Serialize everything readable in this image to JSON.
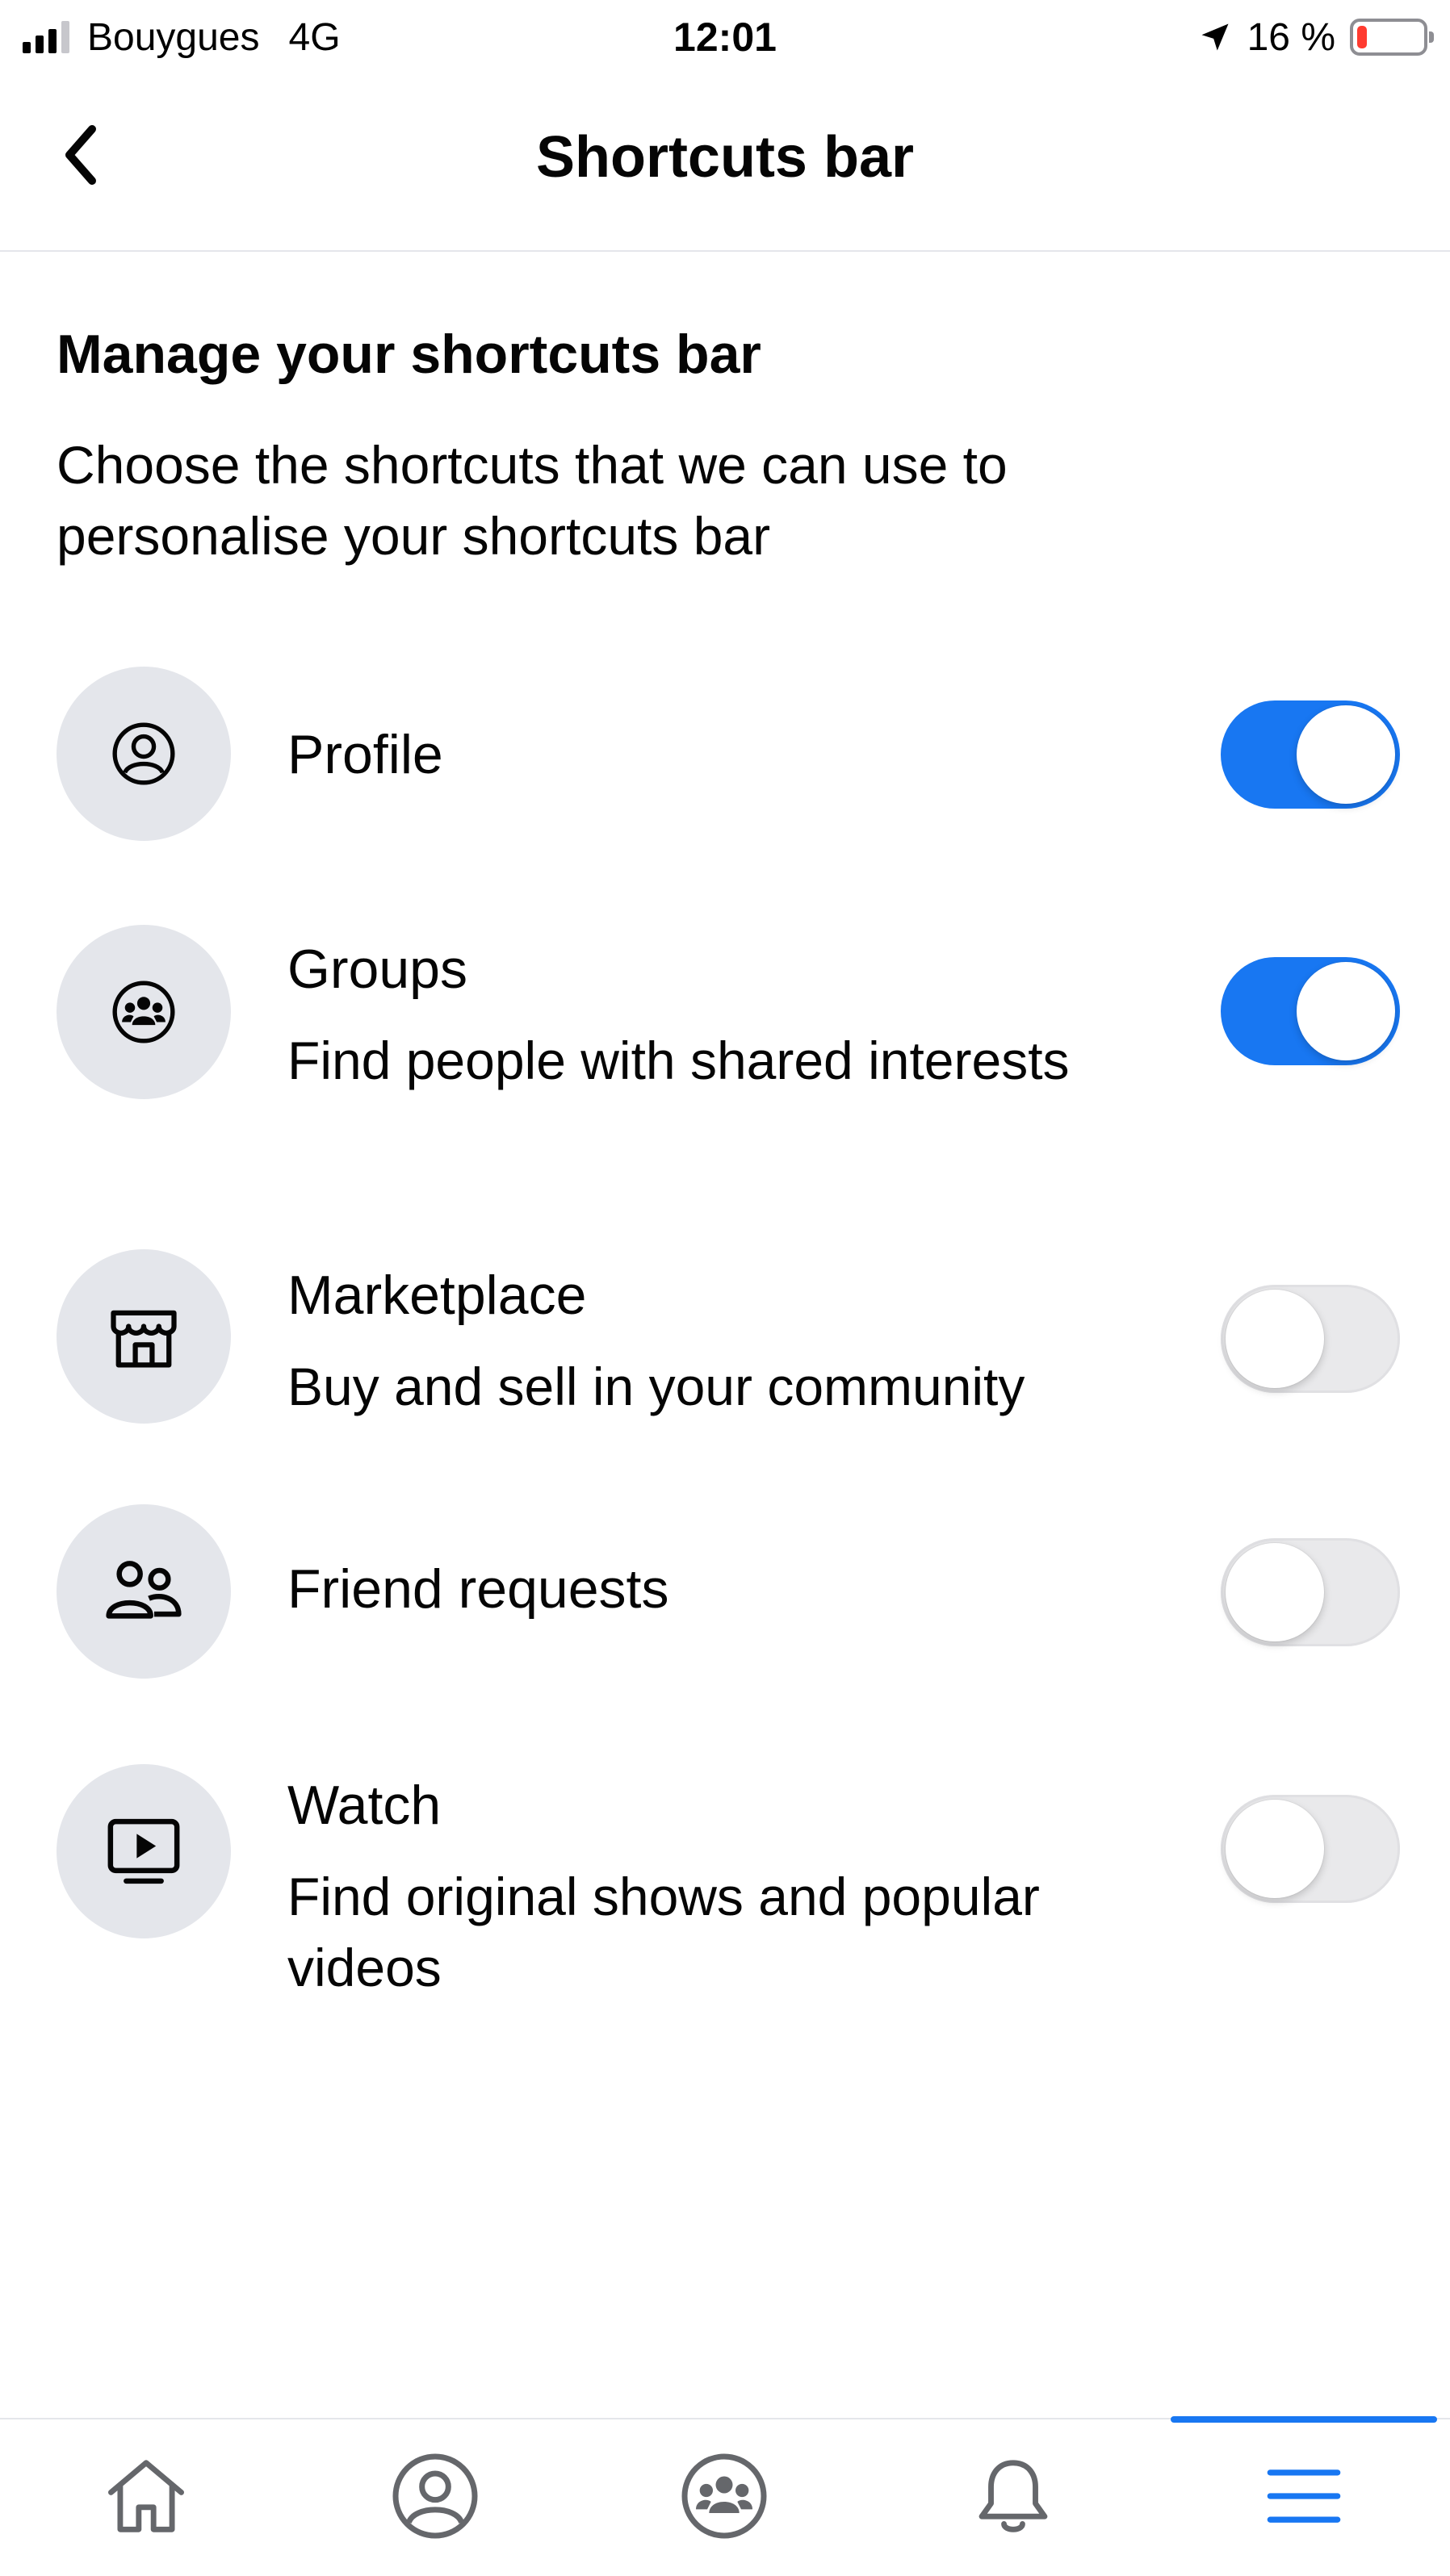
{
  "status_bar": {
    "carrier": "Bouygues",
    "network": "4G",
    "time": "12:01",
    "battery": "16 %",
    "battery_level": 0.16
  },
  "header": {
    "title": "Shortcuts bar",
    "back_icon": "chevron-left-icon"
  },
  "section": {
    "title": "Manage your shortcuts bar",
    "description": "Choose the shortcuts that we can use to personalise your shortcuts bar"
  },
  "shortcuts": [
    {
      "label": "Profile",
      "subtitle": "",
      "icon": "profile-icon",
      "enabled": true
    },
    {
      "label": "Groups",
      "subtitle": "Find people with shared interests",
      "icon": "groups-icon",
      "enabled": true
    },
    {
      "label": "Marketplace",
      "subtitle": "Buy and sell in your community",
      "icon": "marketplace-icon",
      "enabled": false
    },
    {
      "label": "Friend requests",
      "subtitle": "",
      "icon": "friends-icon",
      "enabled": false
    },
    {
      "label": "Watch",
      "subtitle": "Find original shows and popular videos",
      "icon": "watch-icon",
      "enabled": false
    }
  ],
  "tabbar": {
    "tabs": [
      "home-icon",
      "profile-icon",
      "groups-icon",
      "bell-icon",
      "menu-icon"
    ],
    "active_tab": "menu-icon"
  },
  "colors": {
    "accent": "#1877f2",
    "icon_bg": "#e4e6eb",
    "toggle_off": "#e9e9eb",
    "battery_low": "#ff3b30"
  }
}
